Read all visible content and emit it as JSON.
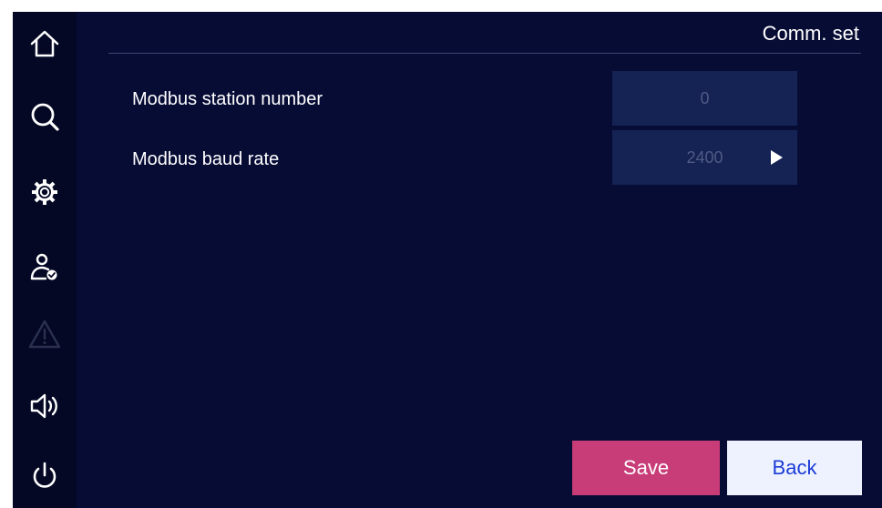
{
  "header": {
    "title": "Comm. set"
  },
  "sidebar": {
    "items": [
      {
        "name": "home",
        "icon": "home-icon",
        "enabled": true
      },
      {
        "name": "search",
        "icon": "search-icon",
        "enabled": true
      },
      {
        "name": "settings",
        "icon": "gear-icon",
        "enabled": true
      },
      {
        "name": "user",
        "icon": "user-check-icon",
        "enabled": true
      },
      {
        "name": "alarm",
        "icon": "warning-icon",
        "enabled": false
      },
      {
        "name": "sound",
        "icon": "speaker-icon",
        "enabled": true
      },
      {
        "name": "power",
        "icon": "power-icon",
        "enabled": true
      }
    ]
  },
  "settings": {
    "station_number": {
      "label": "Modbus station number",
      "value": "0"
    },
    "baud_rate": {
      "label": "Modbus baud rate",
      "value": "2400"
    }
  },
  "buttons": {
    "save_label": "Save",
    "back_label": "Back"
  },
  "colors": {
    "background": "#070c35",
    "sidebar": "#040825",
    "field": "#142254",
    "field_text": "#4f5b84",
    "save": "#c83c78",
    "back": "#eef2ff",
    "back_text": "#1a3bd6"
  }
}
